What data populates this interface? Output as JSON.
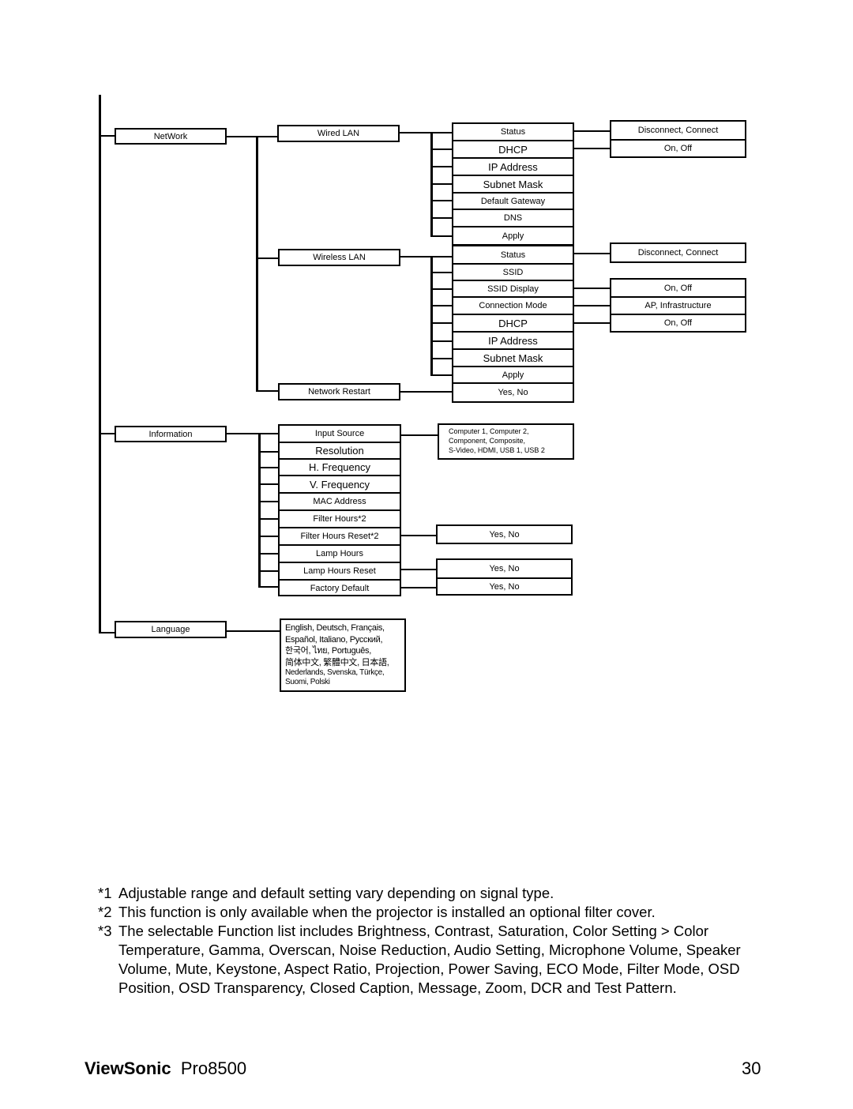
{
  "diagram": {
    "level1": {
      "network": "NetWork",
      "information": "Information",
      "language": "Language"
    },
    "network": {
      "wired_lan": "Wired LAN",
      "wireless_lan": "Wireless LAN",
      "network_restart": "Network Restart",
      "wired_items": [
        "Status",
        "DHCP",
        "IP Address",
        "Subnet Mask",
        "Default Gateway",
        "DNS",
        "Apply"
      ],
      "wired_options": {
        "status": "Disconnect, Connect",
        "dhcp": "On, Off"
      },
      "wireless_items": [
        "Status",
        "SSID",
        "SSID Display",
        "Connection Mode",
        "DHCP",
        "IP Address",
        "Subnet Mask",
        "Apply"
      ],
      "wireless_options": {
        "status": "Disconnect, Connect",
        "ssid_display": "On, Off",
        "connection_mode": "AP, Infrastructure",
        "dhcp": "On, Off"
      },
      "restart_option": "Yes, No"
    },
    "information": {
      "items": [
        "Input Source",
        "Resolution",
        "H. Frequency",
        "V. Frequency",
        "MAC Address",
        "Filter Hours*2",
        "Filter Hours Reset*2",
        "Lamp Hours",
        "Lamp Hours Reset",
        "Factory Default"
      ],
      "input_source_options": [
        "Computer  1, Computer 2,",
        "Component, Composite,",
        "S-Video, HDMI, USB 1, USB 2"
      ],
      "filter_hours_reset_option": "Yes, No",
      "lamp_hours_reset_option": "Yes, No",
      "factory_default_option": "Yes, No"
    },
    "language": {
      "options": [
        "English, Deutsch, Français,",
        "Español, Italiano, Русский,",
        "한국어, ไทย, Português,",
        "简体中文, 繁體中文, 日本語,",
        "Nederlands, Svenska, Türkçe,",
        "Suomi, Polski"
      ]
    }
  },
  "notes": [
    {
      "marker": "*1",
      "text": "Adjustable range and default setting vary depending on signal type."
    },
    {
      "marker": "*2",
      "text": "This function is only available when the projector is installed an optional filter cover."
    },
    {
      "marker": "*3",
      "text": "The selectable Function list includes Brightness, Contrast, Saturation, Color Setting > Color Temperature, Gamma, Overscan, Noise Reduction, Audio Setting, Microphone Volume, Speaker Volume, Mute, Keystone, Aspect Ratio, Projection, Power Saving, ECO Mode, Filter Mode, OSD Position, OSD Transparency, Closed Caption, Message, Zoom, DCR and Test Pattern."
    }
  ],
  "footer": {
    "brand": "ViewSonic",
    "model": "Pro8500",
    "page_number": "30"
  }
}
